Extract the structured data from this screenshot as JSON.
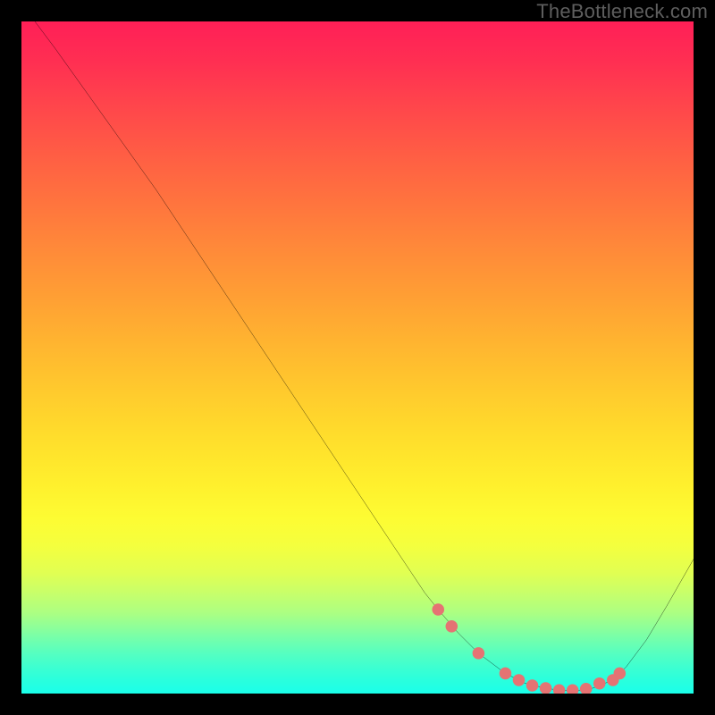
{
  "watermark": "TheBottleneck.com",
  "chart_data": {
    "type": "line",
    "title": "",
    "xlabel": "",
    "ylabel": "",
    "xlim": [
      0,
      100
    ],
    "ylim": [
      0,
      100
    ],
    "grid": false,
    "series": [
      {
        "name": "bottleneck-curve",
        "x": [
          2,
          5,
          10,
          15,
          20,
          25,
          30,
          35,
          40,
          45,
          50,
          55,
          58,
          60,
          62,
          65,
          68,
          72,
          75,
          78,
          80,
          83,
          85,
          88,
          90,
          93,
          96,
          100
        ],
        "y": [
          100,
          96,
          89,
          82,
          75,
          67.5,
          60,
          52.5,
          45,
          37.5,
          30,
          22.5,
          18,
          15,
          12.5,
          9,
          6,
          3,
          1.5,
          0.8,
          0.5,
          0.5,
          0.8,
          2,
          4,
          8,
          13,
          20
        ]
      }
    ],
    "markers": {
      "name": "highlight-dots",
      "color": "#e57373",
      "points": [
        {
          "x": 62,
          "y": 12.5
        },
        {
          "x": 64,
          "y": 10
        },
        {
          "x": 68,
          "y": 6
        },
        {
          "x": 72,
          "y": 3
        },
        {
          "x": 74,
          "y": 2
        },
        {
          "x": 76,
          "y": 1.2
        },
        {
          "x": 78,
          "y": 0.8
        },
        {
          "x": 80,
          "y": 0.5
        },
        {
          "x": 82,
          "y": 0.5
        },
        {
          "x": 84,
          "y": 0.7
        },
        {
          "x": 86,
          "y": 1.5
        },
        {
          "x": 88,
          "y": 2
        },
        {
          "x": 89,
          "y": 3
        }
      ]
    }
  }
}
